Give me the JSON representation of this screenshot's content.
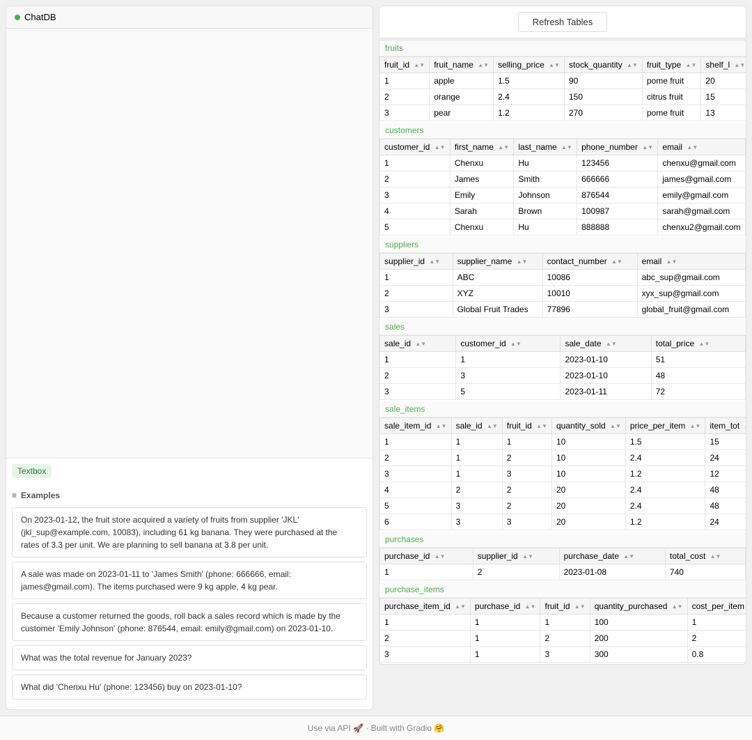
{
  "left_panel": {
    "title": "ChatDB",
    "textbox_label": "Textbox",
    "examples_label": "Examples",
    "examples": [
      "On 2023-01-12, the fruit store acquired a variety of fruits from supplier 'JKL' (jkl_sup@example.com, 10083), including 61 kg banana. They were purchased at the rates of 3.3 per unit. We are planning to sell banana at 3.8 per unit.",
      "A sale was made on 2023-01-11 to 'James Smith' (phone: 666666, email: james@gmail.com). The items purchased were 9 kg apple, 4 kg pear.",
      "Because a customer returned the goods, roll back a sales record which is made by the customer 'Emily Johnson' (phone: 876544, email: emily@gmail.com) on 2023-01-10.",
      "What was the total revenue for January 2023?",
      "What did 'Chenxu Hu' (phone: 123456) buy on 2023-01-10?"
    ]
  },
  "right_panel": {
    "refresh_button": "Refresh Tables",
    "tables": {
      "fruits": {
        "title": "fruits",
        "columns": [
          "fruit_id",
          "fruit_name",
          "selling_price",
          "stock_quantity",
          "fruit_type",
          "shelf_l"
        ],
        "rows": [
          [
            "1",
            "apple",
            "1.5",
            "90",
            "pome fruit",
            "20"
          ],
          [
            "2",
            "orange",
            "2.4",
            "150",
            "citrus fruit",
            "15"
          ],
          [
            "3",
            "pear",
            "1.2",
            "270",
            "pome fruit",
            "13"
          ]
        ]
      },
      "customers": {
        "title": "customers",
        "columns": [
          "customer_id",
          "first_name",
          "last_name",
          "phone_number",
          "email"
        ],
        "rows": [
          [
            "1",
            "Chenxu",
            "Hu",
            "123456",
            "chenxu@gmail.com"
          ],
          [
            "2",
            "James",
            "Smith",
            "666666",
            "james@gmail.com"
          ],
          [
            "3",
            "Emily",
            "Johnson",
            "876544",
            "emily@gmail.com"
          ],
          [
            "4",
            "Sarah",
            "Brown",
            "100987",
            "sarah@gmail.com"
          ],
          [
            "5",
            "Chenxu",
            "Hu",
            "888888",
            "chenxu2@gmail.com"
          ]
        ]
      },
      "suppliers": {
        "title": "suppliers",
        "columns": [
          "supplier_id",
          "supplier_name",
          "contact_number",
          "email"
        ],
        "rows": [
          [
            "1",
            "ABC",
            "10086",
            "abc_sup@gmail.com"
          ],
          [
            "2",
            "XYZ",
            "10010",
            "xyx_sup@gmail.com"
          ],
          [
            "3",
            "Global Fruit Trades",
            "77896",
            "global_fruit@gmail.com"
          ]
        ]
      },
      "sales": {
        "title": "sales",
        "columns": [
          "sale_id",
          "customer_id",
          "sale_date",
          "total_price"
        ],
        "rows": [
          [
            "1",
            "1",
            "2023-01-10",
            "51"
          ],
          [
            "2",
            "3",
            "2023-01-10",
            "48"
          ],
          [
            "3",
            "5",
            "2023-01-11",
            "72"
          ]
        ]
      },
      "sale_items": {
        "title": "sale_items",
        "columns": [
          "sale_item_id",
          "sale_id",
          "fruit_id",
          "quantity_sold",
          "price_per_item",
          "item_tot"
        ],
        "rows": [
          [
            "1",
            "1",
            "1",
            "10",
            "1.5",
            "15"
          ],
          [
            "2",
            "1",
            "2",
            "10",
            "2.4",
            "24"
          ],
          [
            "3",
            "1",
            "3",
            "10",
            "1.2",
            "12"
          ],
          [
            "4",
            "2",
            "2",
            "20",
            "2.4",
            "48"
          ],
          [
            "5",
            "3",
            "2",
            "20",
            "2.4",
            "48"
          ],
          [
            "6",
            "3",
            "3",
            "20",
            "1.2",
            "24"
          ]
        ]
      },
      "purchases": {
        "title": "purchases",
        "columns": [
          "purchase_id",
          "supplier_id",
          "purchase_date",
          "total_cost"
        ],
        "rows": [
          [
            "1",
            "2",
            "2023-01-08",
            "740"
          ]
        ]
      },
      "purchase_items": {
        "title": "purchase_items",
        "columns": [
          "purchase_item_id",
          "purchase_id",
          "fruit_id",
          "quantity_purchased",
          "cost_per_item"
        ],
        "rows": [
          [
            "1",
            "1",
            "1",
            "100",
            "1"
          ],
          [
            "2",
            "1",
            "2",
            "200",
            "2"
          ],
          [
            "3",
            "1",
            "3",
            "300",
            "0.8"
          ]
        ]
      }
    }
  },
  "footer": {
    "text": "Use via API 🚀 · Built with Gradio 🤗"
  },
  "icons": {
    "hamburger": "≡",
    "dot_icon": "●"
  }
}
